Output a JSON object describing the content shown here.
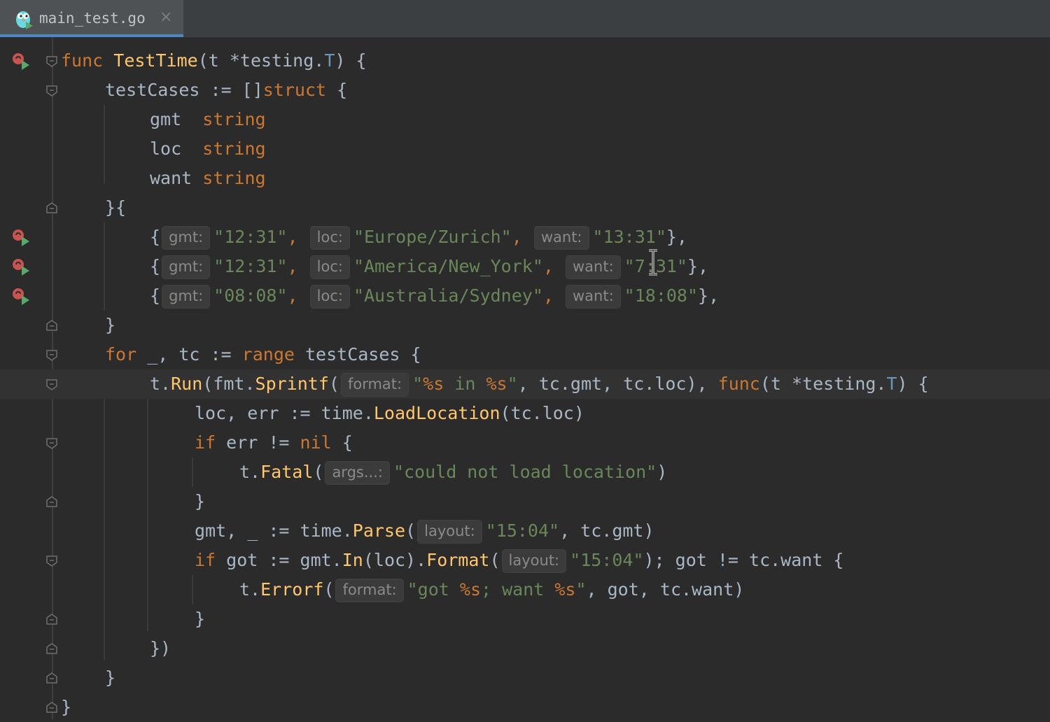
{
  "tab": {
    "title": "main_test.go",
    "close_glyph": "×"
  },
  "icons": {
    "file": "go-gopher-icon",
    "run": "run-test-icon",
    "fold": "fold-icon"
  },
  "colors": {
    "background": "#2b2b2b",
    "keyword": "#cc7832",
    "function": "#ffc66d",
    "string": "#6a8759",
    "text": "#a9b7c6",
    "accent": "#4a88c7"
  },
  "code": {
    "l1": [
      "func",
      "TestTime",
      "(t *testing.",
      "T",
      ") {"
    ],
    "l2": [
      "testCases := []",
      "struct",
      " {"
    ],
    "l3": [
      "gmt  ",
      "string"
    ],
    "l4": [
      "loc  ",
      "string"
    ],
    "l5": [
      "want ",
      "string"
    ],
    "l6": [
      "}{"
    ],
    "l7": [
      "{",
      "gmt:",
      "\"12:31\"",
      ", ",
      "loc:",
      "\"Europe/Zurich\"",
      ", ",
      "want:",
      "\"13:31\"",
      "},"
    ],
    "l8": [
      "{",
      "gmt:",
      "\"12:31\"",
      ", ",
      "loc:",
      "\"America/New_York\"",
      ", ",
      "want:",
      "\"7:31\"",
      "},"
    ],
    "l9": [
      "{",
      "gmt:",
      "\"08:08\"",
      ", ",
      "loc:",
      "\"Australia/Sydney\"",
      ", ",
      "want:",
      "\"18:08\"",
      "},"
    ],
    "l10": [
      "}"
    ],
    "l11": [
      "for",
      " _, tc := ",
      "range",
      " testCases {"
    ],
    "l12": [
      "t.",
      "Run",
      "(fmt.",
      "Sprintf",
      "(",
      "format:",
      "\"",
      "%s",
      " in ",
      "%s",
      "\"",
      ", tc.gmt, tc.loc), ",
      "func",
      "(t *testing.",
      "T",
      ") {"
    ],
    "l13": [
      "loc, err := time.",
      "LoadLocation",
      "(tc.loc)"
    ],
    "l14": [
      "if",
      " err != ",
      "nil",
      " {"
    ],
    "l15": [
      "t.",
      "Fatal",
      "(",
      "args...:",
      "\"could not load location\"",
      ")"
    ],
    "l16": [
      "}"
    ],
    "l17": [
      "gmt, _ := time.",
      "Parse",
      "(",
      "layout:",
      "\"15:04\"",
      ", tc.gmt)"
    ],
    "l18": [
      "if",
      " got := gmt.",
      "In",
      "(loc).",
      "Format",
      "(",
      "layout:",
      "\"15:04\"",
      "); got != tc.want {"
    ],
    "l19": [
      "t.",
      "Errorf",
      "(",
      "format:",
      "\"got ",
      "%s",
      "; want ",
      "%s",
      "\"",
      ", got, tc.want)"
    ],
    "l20": [
      "}"
    ],
    "l21": [
      "})"
    ],
    "l22": [
      "}"
    ],
    "l23": [
      "}"
    ]
  }
}
